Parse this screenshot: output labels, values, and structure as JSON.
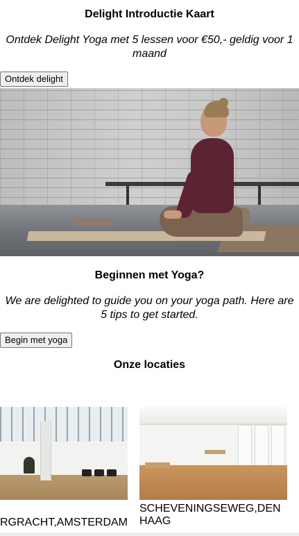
{
  "intro": {
    "title": "Delight Introductie Kaart",
    "subtitle": "Ontdek Delight Yoga met 5 lessen voor €50,- geldig voor 1 maand",
    "button_label": "Ontdek delight"
  },
  "beginners": {
    "title": "Beginnen met Yoga?",
    "subtitle": "We are delighted to guide you on your yoga path. Here are 5 tips to get started.",
    "button_label": "Begin met yoga"
  },
  "locations": {
    "title": "Onze locaties",
    "items": [
      {
        "caption": "RGRACHT,AMSTERDAM"
      },
      {
        "caption": "SCHEVENINGSEWEG,DEN HAAG"
      }
    ]
  }
}
